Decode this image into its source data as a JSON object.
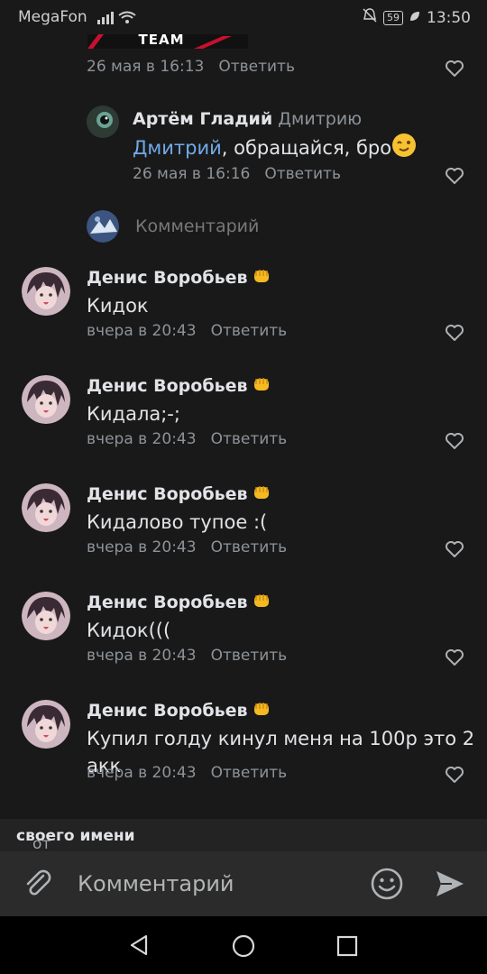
{
  "status_bar": {
    "carrier": "MegaFon",
    "battery": "59",
    "time": "13:50"
  },
  "banner": {
    "text": "TEAM"
  },
  "top_comment": {
    "date": "26 мая в 16:13",
    "reply_label": "Ответить"
  },
  "reply_comment": {
    "author": "Артём Гладий",
    "reply_to": "Дмитрию",
    "mention": "Дмитрий",
    "text": ", обращайся, бро",
    "date": "26 мая в 16:16",
    "reply_label": "Ответить"
  },
  "reply_input": {
    "placeholder": "Комментарий"
  },
  "comments": [
    {
      "author": "Денис Воробьев",
      "text": "Кидок",
      "date": "вчера в 20:43",
      "reply_label": "Ответить"
    },
    {
      "author": "Денис Воробьев",
      "text": "Кидала;-;",
      "date": "вчера в 20:43",
      "reply_label": "Ответить"
    },
    {
      "author": "Денис Воробьев",
      "text": "Кидалово тупое :(",
      "date": "вчера в 20:43",
      "reply_label": "Ответить"
    },
    {
      "author": "Денис Воробьев",
      "text": "Кидок(((",
      "date": "вчера в 20:43",
      "reply_label": "Ответить"
    },
    {
      "author": "Денис Воробьев",
      "text_line1": "Купил голду кинул меня на 100р это 2",
      "text_line2": "акк",
      "date": "вчера в 20:43",
      "reply_label": "Ответить"
    }
  ],
  "from_bar": {
    "prefix": "от",
    "name": "своего имени"
  },
  "composer": {
    "placeholder": "Комментарий"
  },
  "icons": {
    "attach": "paperclip-icon",
    "emoji": "smile-icon",
    "send": "send-icon",
    "like": "heart-icon"
  }
}
